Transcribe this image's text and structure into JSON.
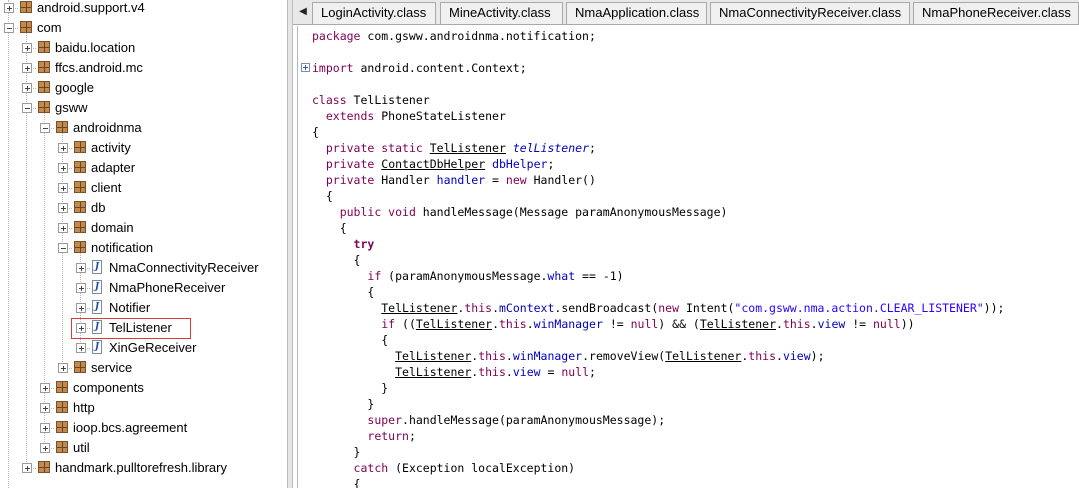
{
  "tree": {
    "rows": [
      {
        "label": "android.support.v4",
        "depth": 0,
        "type": "package",
        "state": "collapsed"
      },
      {
        "label": "com",
        "depth": 0,
        "type": "package",
        "state": "expanded"
      },
      {
        "label": "baidu.location",
        "depth": 1,
        "type": "package",
        "state": "collapsed"
      },
      {
        "label": "ffcs.android.mc",
        "depth": 1,
        "type": "package",
        "state": "collapsed"
      },
      {
        "label": "google",
        "depth": 1,
        "type": "package",
        "state": "collapsed"
      },
      {
        "label": "gsww",
        "depth": 1,
        "type": "package",
        "state": "expanded"
      },
      {
        "label": "androidnma",
        "depth": 2,
        "type": "package",
        "state": "expanded"
      },
      {
        "label": "activity",
        "depth": 3,
        "type": "package",
        "state": "collapsed"
      },
      {
        "label": "adapter",
        "depth": 3,
        "type": "package",
        "state": "collapsed"
      },
      {
        "label": "client",
        "depth": 3,
        "type": "package",
        "state": "collapsed"
      },
      {
        "label": "db",
        "depth": 3,
        "type": "package",
        "state": "collapsed"
      },
      {
        "label": "domain",
        "depth": 3,
        "type": "package",
        "state": "collapsed"
      },
      {
        "label": "notification",
        "depth": 3,
        "type": "package",
        "state": "expanded"
      },
      {
        "label": "NmaConnectivityReceiver",
        "depth": 4,
        "type": "class",
        "state": "collapsed"
      },
      {
        "label": "NmaPhoneReceiver",
        "depth": 4,
        "type": "class",
        "state": "collapsed"
      },
      {
        "label": "Notifier",
        "depth": 4,
        "type": "class",
        "state": "collapsed"
      },
      {
        "label": "TelListener",
        "depth": 4,
        "type": "class",
        "state": "collapsed",
        "highlighted": true
      },
      {
        "label": "XinGeReceiver",
        "depth": 4,
        "type": "class",
        "state": "collapsed"
      },
      {
        "label": "service",
        "depth": 3,
        "type": "package",
        "state": "collapsed"
      },
      {
        "label": "components",
        "depth": 2,
        "type": "package",
        "state": "collapsed"
      },
      {
        "label": "http",
        "depth": 2,
        "type": "package",
        "state": "collapsed"
      },
      {
        "label": "ioop.bcs.agreement",
        "depth": 2,
        "type": "package",
        "state": "collapsed"
      },
      {
        "label": "util",
        "depth": 2,
        "type": "package",
        "state": "collapsed"
      },
      {
        "label": "handmark.pulltorefresh.library",
        "depth": 1,
        "type": "package",
        "state": "collapsed"
      }
    ]
  },
  "tabs": [
    {
      "label": "LoginActivity.class"
    },
    {
      "label": "MineActivity.class"
    },
    {
      "label": "NmaApplication.class"
    },
    {
      "label": "NmaConnectivityReceiver.class"
    },
    {
      "label": "NmaPhoneReceiver.class"
    }
  ],
  "icons": {
    "tab_scroll": "◀",
    "package": "package-icon",
    "class": "java-class-icon"
  },
  "colors": {
    "keyword": "#7f0055",
    "field": "#0000c0",
    "string": "#2a00ff",
    "highlight_box": "#d93a3a"
  },
  "code": {
    "fold_lines": [
      2
    ],
    "lines": [
      [
        {
          "t": "kw2",
          "v": "package"
        },
        {
          "t": "",
          "v": " com.gsww.androidnma.notification;"
        }
      ],
      [],
      [
        {
          "t": "kw2",
          "v": "import"
        },
        {
          "t": "",
          "v": " android.content.Context;"
        }
      ],
      [],
      [
        {
          "t": "kw2",
          "v": "class"
        },
        {
          "t": "",
          "v": " TelListener"
        }
      ],
      [
        {
          "t": "",
          "v": "  "
        },
        {
          "t": "kw2",
          "v": "extends"
        },
        {
          "t": "",
          "v": " PhoneStateListener"
        }
      ],
      [
        {
          "t": "",
          "v": "{"
        }
      ],
      [
        {
          "t": "",
          "v": "  "
        },
        {
          "t": "kw2",
          "v": "private static"
        },
        {
          "t": "",
          "v": " "
        },
        {
          "t": "ref",
          "v": "TelListener"
        },
        {
          "t": "",
          "v": " "
        },
        {
          "t": "ifld",
          "v": "telListener"
        },
        {
          "t": "",
          "v": ";"
        }
      ],
      [
        {
          "t": "",
          "v": "  "
        },
        {
          "t": "kw2",
          "v": "private"
        },
        {
          "t": "",
          "v": " "
        },
        {
          "t": "ref",
          "v": "ContactDbHelper"
        },
        {
          "t": "",
          "v": " "
        },
        {
          "t": "fld",
          "v": "dbHelper"
        },
        {
          "t": "",
          "v": ";"
        }
      ],
      [
        {
          "t": "",
          "v": "  "
        },
        {
          "t": "kw2",
          "v": "private"
        },
        {
          "t": "",
          "v": " Handler "
        },
        {
          "t": "fld",
          "v": "handler"
        },
        {
          "t": "",
          "v": " = "
        },
        {
          "t": "kw2",
          "v": "new"
        },
        {
          "t": "",
          "v": " Handler()"
        }
      ],
      [
        {
          "t": "",
          "v": "  {"
        }
      ],
      [
        {
          "t": "",
          "v": "    "
        },
        {
          "t": "kw2",
          "v": "public void"
        },
        {
          "t": "",
          "v": " handleMessage(Message paramAnonymousMessage)"
        }
      ],
      [
        {
          "t": "",
          "v": "    {"
        }
      ],
      [
        {
          "t": "",
          "v": "      "
        },
        {
          "t": "kw",
          "v": "try"
        }
      ],
      [
        {
          "t": "",
          "v": "      {"
        }
      ],
      [
        {
          "t": "",
          "v": "        "
        },
        {
          "t": "kw2",
          "v": "if"
        },
        {
          "t": "",
          "v": " (paramAnonymousMessage."
        },
        {
          "t": "fld",
          "v": "what"
        },
        {
          "t": "",
          "v": " == -1)"
        }
      ],
      [
        {
          "t": "",
          "v": "        {"
        }
      ],
      [
        {
          "t": "",
          "v": "          "
        },
        {
          "t": "ref",
          "v": "TelListener"
        },
        {
          "t": "",
          "v": "."
        },
        {
          "t": "kw2",
          "v": "this"
        },
        {
          "t": "",
          "v": "."
        },
        {
          "t": "fld",
          "v": "mContext"
        },
        {
          "t": "",
          "v": ".sendBroadcast("
        },
        {
          "t": "kw2",
          "v": "new"
        },
        {
          "t": "",
          "v": " Intent("
        },
        {
          "t": "str",
          "v": "\"com.gsww.nma.action.CLEAR_LISTENER\""
        },
        {
          "t": "",
          "v": "));"
        }
      ],
      [
        {
          "t": "",
          "v": "          "
        },
        {
          "t": "kw2",
          "v": "if"
        },
        {
          "t": "",
          "v": " (("
        },
        {
          "t": "ref",
          "v": "TelListener"
        },
        {
          "t": "",
          "v": "."
        },
        {
          "t": "kw2",
          "v": "this"
        },
        {
          "t": "",
          "v": "."
        },
        {
          "t": "fld",
          "v": "winManager"
        },
        {
          "t": "",
          "v": " != "
        },
        {
          "t": "kw2",
          "v": "null"
        },
        {
          "t": "",
          "v": ") && ("
        },
        {
          "t": "ref",
          "v": "TelListener"
        },
        {
          "t": "",
          "v": "."
        },
        {
          "t": "kw2",
          "v": "this"
        },
        {
          "t": "",
          "v": "."
        },
        {
          "t": "fld",
          "v": "view"
        },
        {
          "t": "",
          "v": " != "
        },
        {
          "t": "kw2",
          "v": "null"
        },
        {
          "t": "",
          "v": "))"
        }
      ],
      [
        {
          "t": "",
          "v": "          {"
        }
      ],
      [
        {
          "t": "",
          "v": "            "
        },
        {
          "t": "ref",
          "v": "TelListener"
        },
        {
          "t": "",
          "v": "."
        },
        {
          "t": "kw2",
          "v": "this"
        },
        {
          "t": "",
          "v": "."
        },
        {
          "t": "fld",
          "v": "winManager"
        },
        {
          "t": "",
          "v": ".removeView("
        },
        {
          "t": "ref",
          "v": "TelListener"
        },
        {
          "t": "",
          "v": "."
        },
        {
          "t": "kw2",
          "v": "this"
        },
        {
          "t": "",
          "v": "."
        },
        {
          "t": "fld",
          "v": "view"
        },
        {
          "t": "",
          "v": ");"
        }
      ],
      [
        {
          "t": "",
          "v": "            "
        },
        {
          "t": "ref",
          "v": "TelListener"
        },
        {
          "t": "",
          "v": "."
        },
        {
          "t": "kw2",
          "v": "this"
        },
        {
          "t": "",
          "v": "."
        },
        {
          "t": "fld",
          "v": "view"
        },
        {
          "t": "",
          "v": " = "
        },
        {
          "t": "kw2",
          "v": "null"
        },
        {
          "t": "",
          "v": ";"
        }
      ],
      [
        {
          "t": "",
          "v": "          }"
        }
      ],
      [
        {
          "t": "",
          "v": "        }"
        }
      ],
      [
        {
          "t": "",
          "v": "        "
        },
        {
          "t": "kw2",
          "v": "super"
        },
        {
          "t": "",
          "v": ".handleMessage(paramAnonymousMessage);"
        }
      ],
      [
        {
          "t": "",
          "v": "        "
        },
        {
          "t": "kw2",
          "v": "return"
        },
        {
          "t": "",
          "v": ";"
        }
      ],
      [
        {
          "t": "",
          "v": "      }"
        }
      ],
      [
        {
          "t": "",
          "v": "      "
        },
        {
          "t": "kw2",
          "v": "catch"
        },
        {
          "t": "",
          "v": " (Exception localException)"
        }
      ],
      [
        {
          "t": "",
          "v": "      {"
        }
      ]
    ]
  }
}
